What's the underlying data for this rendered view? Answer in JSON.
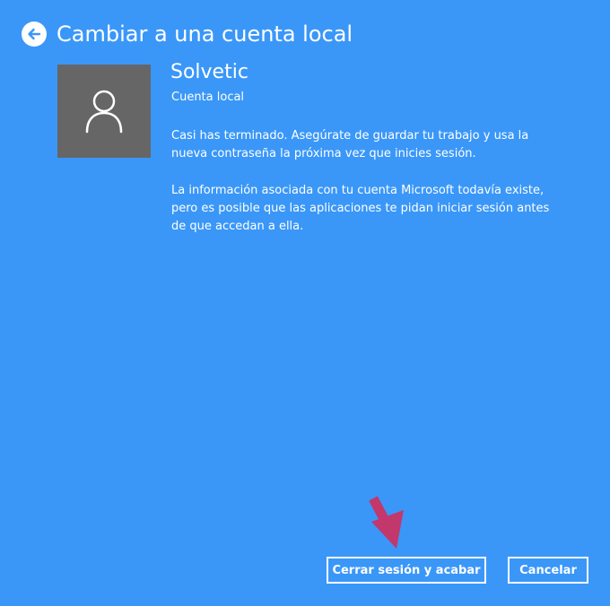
{
  "header": {
    "title": "Cambiar a una cuenta local",
    "back_icon": "back-arrow-circle-icon"
  },
  "account": {
    "avatar_icon": "user-icon",
    "name": "Solvetic",
    "type": "Cuenta local"
  },
  "messages": [
    "Casi has terminado. Asegúrate de guardar tu trabajo y usa la nueva contraseña la próxima vez que inicies sesión.",
    "La información asociada con tu cuenta Microsoft todavía existe, pero es posible que las aplicaciones te pidan iniciar sesión antes de que accedan a ella."
  ],
  "annotation": {
    "icon": "pointer-arrow-icon",
    "color": "#c2386d"
  },
  "buttons": {
    "sign_out_finish": "Cerrar sesión y acabar",
    "cancel": "Cancelar"
  },
  "colors": {
    "background": "#3a97f8",
    "avatar_background": "#666666",
    "text": "#ffffff"
  }
}
